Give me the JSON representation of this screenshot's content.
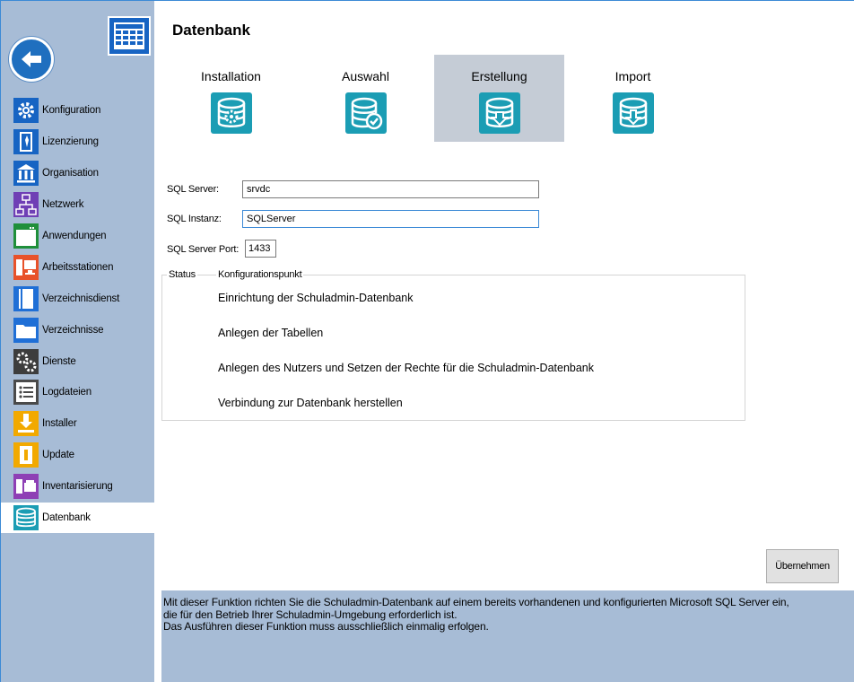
{
  "sidebar": {
    "items": [
      {
        "label": "Konfiguration",
        "icon": "gear-icon"
      },
      {
        "label": "Lizenzierung",
        "icon": "license-icon"
      },
      {
        "label": "Organisation",
        "icon": "building-icon"
      },
      {
        "label": "Netzwerk",
        "icon": "network-icon"
      },
      {
        "label": "Anwendungen",
        "icon": "application-window-icon"
      },
      {
        "label": "Arbeitsstationen",
        "icon": "workstation-icon"
      },
      {
        "label": "Verzeichnisdienst",
        "icon": "directory-book-icon"
      },
      {
        "label": "Verzeichnisse",
        "icon": "folder-icon"
      },
      {
        "label": "Dienste",
        "icon": "services-gears-icon"
      },
      {
        "label": "Logdateien",
        "icon": "log-list-icon"
      },
      {
        "label": "Installer",
        "icon": "installer-download-icon"
      },
      {
        "label": "Update",
        "icon": "update-icon"
      },
      {
        "label": "Inventarisierung",
        "icon": "inventory-icon"
      },
      {
        "label": "Datenbank",
        "icon": "database-icon"
      }
    ],
    "active": "Datenbank"
  },
  "main": {
    "title": "Datenbank",
    "tabs": [
      {
        "label": "Installation",
        "icon": "database-gear-icon"
      },
      {
        "label": "Auswahl",
        "icon": "database-check-icon"
      },
      {
        "label": "Erstellung",
        "icon": "database-create-icon"
      },
      {
        "label": "Import",
        "icon": "database-import-icon"
      }
    ],
    "active_tab": "Erstellung",
    "form": {
      "sql_server_label": "SQL Server:",
      "sql_server_value": "srvdc",
      "sql_instance_label": "SQL Instanz:",
      "sql_instance_value": "SQLServer",
      "sql_port_label": "SQL Server Port:",
      "sql_port_value": "1433"
    },
    "status_group": {
      "status_header": "Status",
      "point_header": "Konfigurationspunkt",
      "steps": [
        "Einrichtung der Schuladmin-Datenbank",
        "Anlegen der Tabellen",
        "Anlegen des Nutzers und Setzen der Rechte für die Schuladmin-Datenbank",
        "Verbindung zur Datenbank herstellen"
      ]
    },
    "apply_label": "Übernehmen",
    "info_lines": [
      "Mit dieser Funktion richten Sie die Schuladmin-Datenbank auf einem bereits vorhandenen und konfigurierten Microsoft SQL Server ein,",
      "die für den Betrieb Ihrer Schuladmin-Umgebung erforderlich ist.",
      "Das Ausführen dieser Funktion muss ausschließlich einmalig erfolgen."
    ]
  },
  "colors": {
    "sidebar_bg": "#a7bcd6",
    "accent_blue": "#1f6fbf",
    "tab_icon_teal": "#1b9db4",
    "active_tab_bg": "#c5ccd6"
  }
}
